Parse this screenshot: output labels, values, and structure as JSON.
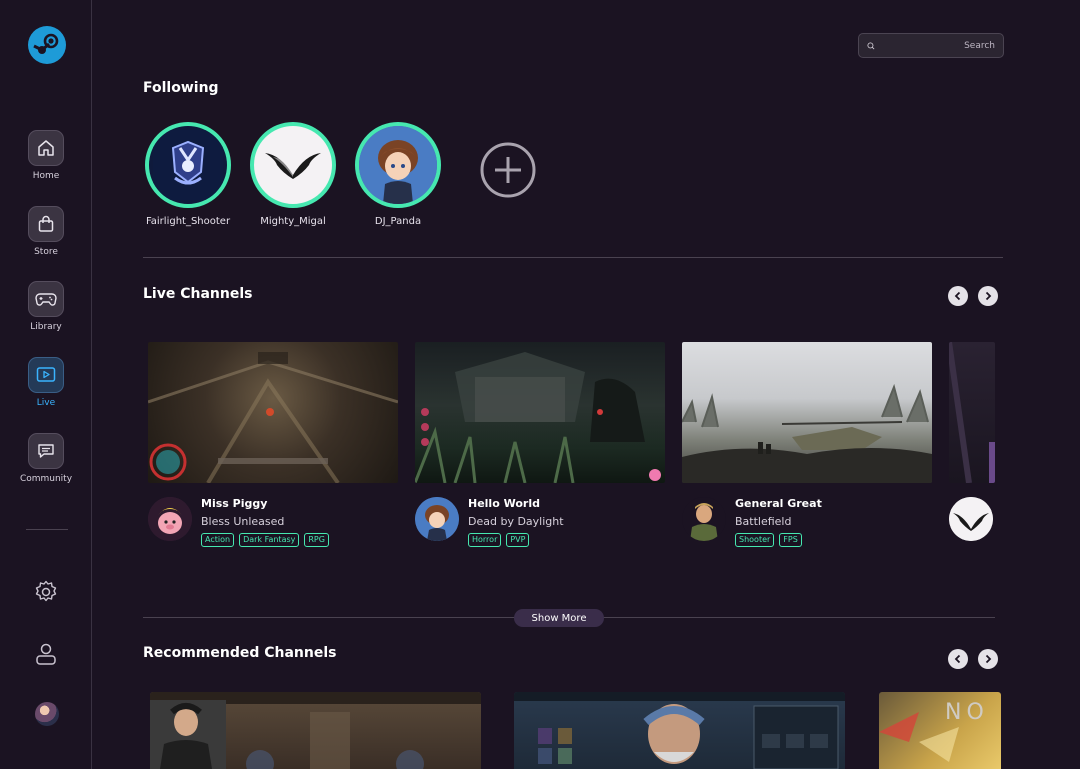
{
  "sidebar": {
    "logo": "steam-logo-icon",
    "items": [
      {
        "label": "Home",
        "icon": "home-icon"
      },
      {
        "label": "Store",
        "icon": "shopping-bag-icon"
      },
      {
        "label": "Library",
        "icon": "gamepad-icon"
      },
      {
        "label": "Live",
        "icon": "play-icon",
        "active": true
      },
      {
        "label": "Community",
        "icon": "chat-icon"
      }
    ],
    "bottom_icons": [
      "gear-icon",
      "user-icon",
      "avatar"
    ]
  },
  "search": {
    "placeholder": "Search",
    "icon": "search-icon"
  },
  "following": {
    "title": "Following",
    "channels": [
      {
        "name": "Fairlight_Shooter"
      },
      {
        "name": "Mighty_Migal"
      },
      {
        "name": "DJ_Panda"
      }
    ],
    "add_icon": "plus-circle-icon"
  },
  "live": {
    "title": "Live Channels",
    "cards": [
      {
        "streamer": "Miss Piggy",
        "game": "Bless Unleased",
        "tags": [
          "Action",
          "Dark Fantasy",
          "RPG"
        ]
      },
      {
        "streamer": "Hello World",
        "game": "Dead by Daylight",
        "tags": [
          "Horror",
          "PVP"
        ]
      },
      {
        "streamer": "General Great",
        "game": "Battlefield",
        "tags": [
          "Shooter",
          "FPS"
        ]
      }
    ]
  },
  "show_more_label": "Show More",
  "recommended": {
    "title": "Recommended Channels",
    "thumb_texts": [
      "NO"
    ]
  },
  "colors": {
    "background": "#1b1322",
    "accent": "#46e8b0",
    "active": "#3ab4ff"
  }
}
